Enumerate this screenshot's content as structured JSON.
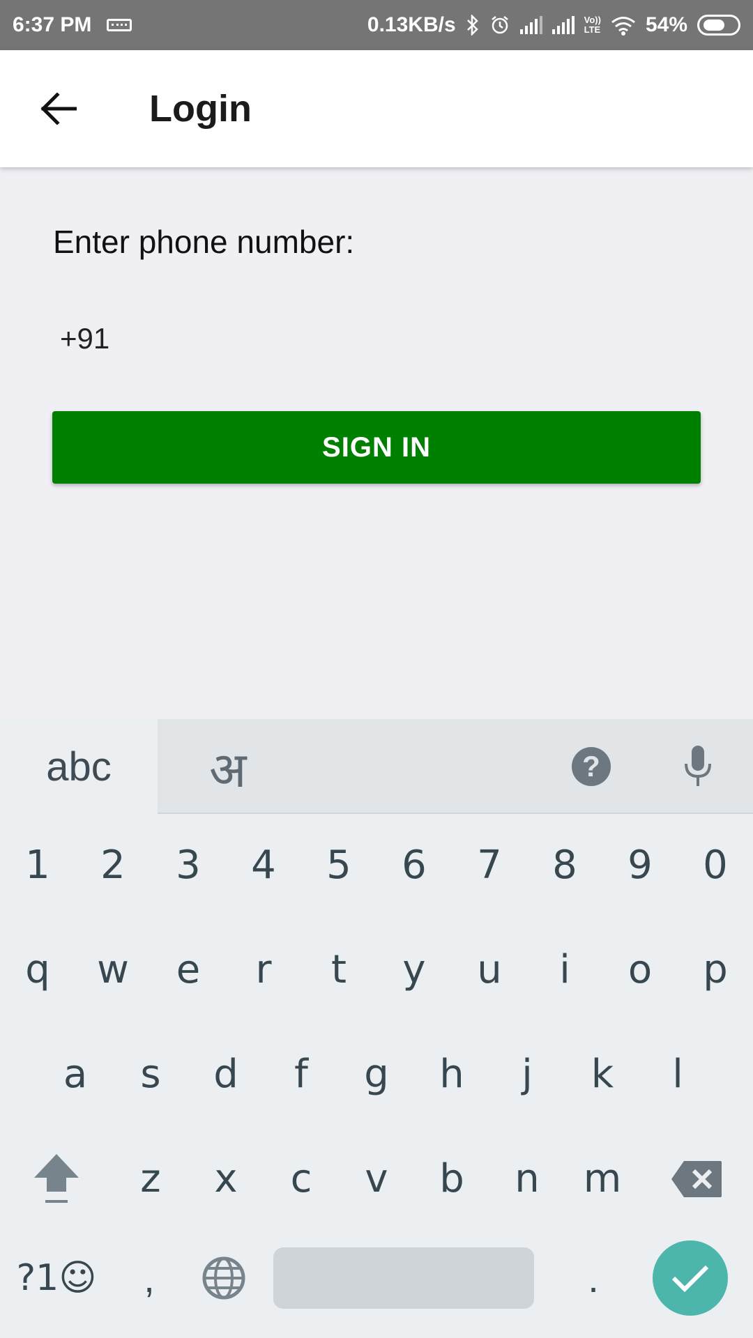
{
  "status_bar": {
    "time": "6:37 PM",
    "network_speed": "0.13KB/s",
    "battery_percent": "54%",
    "icons": [
      "keyboard-icon",
      "bluetooth-icon",
      "alarm-icon",
      "signal-icon",
      "signal-icon",
      "volte-icon",
      "wifi-icon",
      "battery-icon"
    ],
    "volte_text_top": "Vo))",
    "volte_text_bottom": "LTE"
  },
  "app_bar": {
    "title": "Login",
    "back_icon": "arrow-back-icon"
  },
  "form": {
    "phone_label": "Enter phone number:",
    "phone_value": "+91",
    "signin_label": "SIGN IN",
    "signin_color": "#008000"
  },
  "keyboard": {
    "tab_abc": "abc",
    "tab_hindi": "अ",
    "help": "?",
    "number_row": [
      "1",
      "2",
      "3",
      "4",
      "5",
      "6",
      "7",
      "8",
      "9",
      "0"
    ],
    "row_q": [
      "q",
      "w",
      "e",
      "r",
      "t",
      "y",
      "u",
      "i",
      "o",
      "p"
    ],
    "row_a": [
      "a",
      "s",
      "d",
      "f",
      "g",
      "h",
      "j",
      "k",
      "l"
    ],
    "row_z": [
      "z",
      "x",
      "c",
      "v",
      "b",
      "n",
      "m"
    ],
    "symbols_label": "?1☺",
    "comma": ",",
    "period": ".",
    "enter_color": "#4db6ac"
  }
}
